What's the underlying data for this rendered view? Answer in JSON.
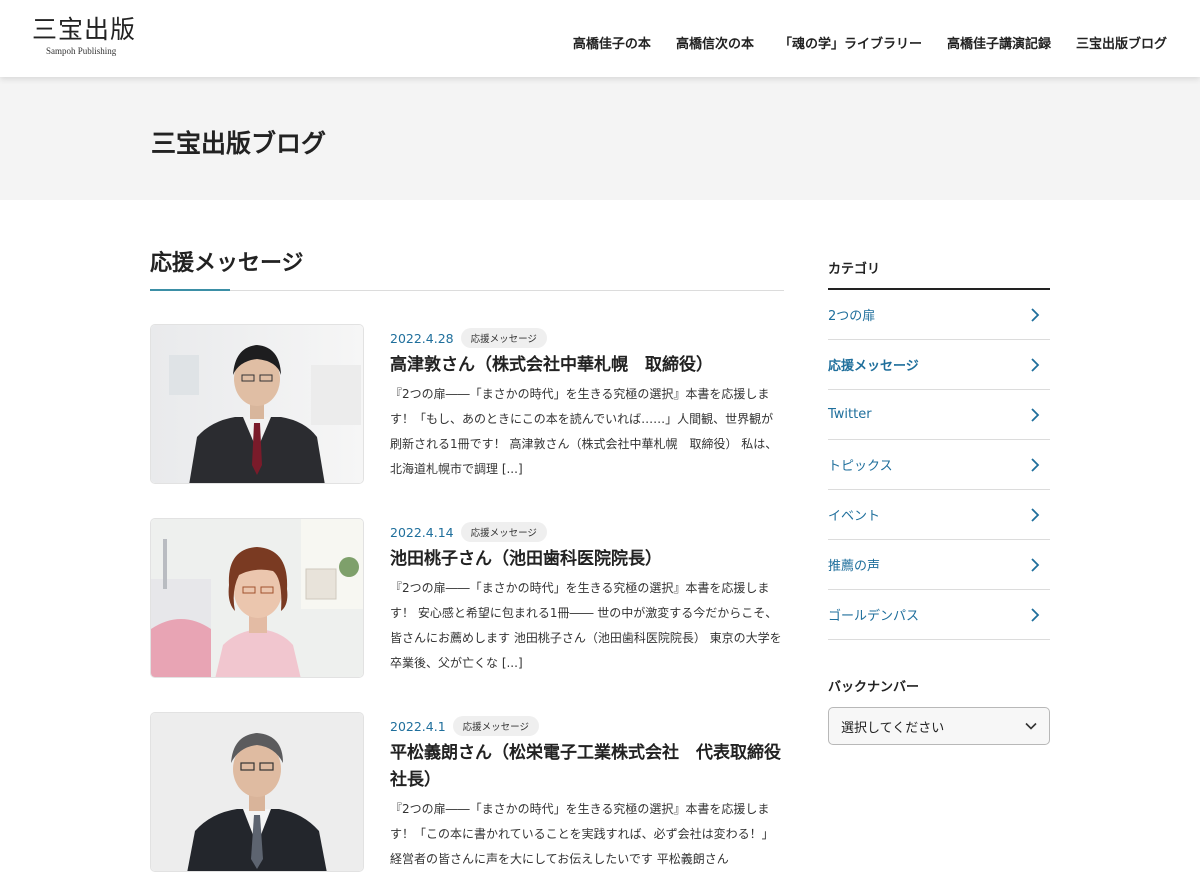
{
  "header": {
    "logo_main": "三宝出版",
    "logo_sub": "Sampoh Publishing",
    "nav": [
      {
        "label": "高橋佳子の本"
      },
      {
        "label": "高橋信次の本"
      },
      {
        "label": "「魂の学」ライブラリー"
      },
      {
        "label": "高橋佳子講演記録"
      },
      {
        "label": "三宝出版ブログ"
      }
    ]
  },
  "page_title": "三宝出版ブログ",
  "section_title": "応援メッセージ",
  "posts": [
    {
      "date": "2022.4.28",
      "category": "応援メッセージ",
      "title": "高津敦さん（株式会社中華札幌　取締役）",
      "excerpt": "『2つの扉――「まさかの時代」を生きる究極の選択』本書を応援します！「もし、あのときにこの本を読んでいれば……」人間観、世界観が刷新される1冊です！ 高津敦さん（株式会社中華札幌　取締役） 私は、北海道札幌市で調理 [...]",
      "thumb_alt": "man-in-suit-photo"
    },
    {
      "date": "2022.4.14",
      "category": "応援メッセージ",
      "title": "池田桃子さん（池田歯科医院院長）",
      "excerpt": "『2つの扉――「まさかの時代」を生きる究極の選択』本書を応援します！ 安心感と希望に包まれる1冊―― 世の中が激変する今だからこそ、皆さんにお薦めします 池田桃子さん（池田歯科医院院長） 東京の大学を卒業後、父が亡くな [...]",
      "thumb_alt": "woman-dentist-photo"
    },
    {
      "date": "2022.4.1",
      "category": "応援メッセージ",
      "title": "平松義朗さん（松栄電子工業株式会社　代表取締役社長）",
      "excerpt": "『2つの扉――「まさかの時代」を生きる究極の選択』本書を応援します！「この本に書かれていることを実践すれば、必ず会社は変わる！」経営者の皆さんに声を大にしてお伝えしたいです 平松義朗さん",
      "thumb_alt": "man-with-glasses-photo"
    }
  ],
  "sidebar": {
    "category_heading": "カテゴリ",
    "categories": [
      {
        "label": "2つの扉"
      },
      {
        "label": "応援メッセージ"
      },
      {
        "label": "Twitter"
      },
      {
        "label": "トピックス"
      },
      {
        "label": "イベント"
      },
      {
        "label": "推薦の声"
      },
      {
        "label": "ゴールデンパス"
      }
    ],
    "active_category": "応援メッセージ",
    "archive_heading": "バックナンバー",
    "archive_select": "選択してください"
  },
  "colors": {
    "accent": "#1f6f9c",
    "section_accent": "#3b8fa6",
    "title_band": "#f4f4f4"
  }
}
